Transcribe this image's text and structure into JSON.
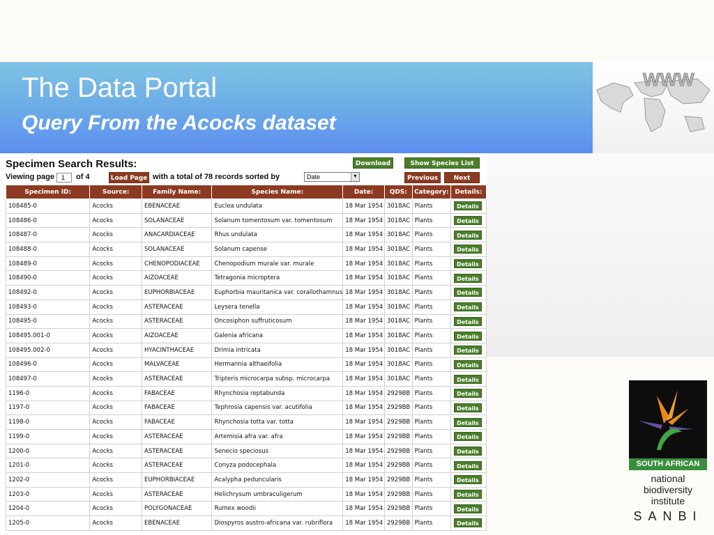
{
  "slide": {
    "title": "The Data Portal",
    "subtitle": "Query From the Acocks dataset",
    "globe_label": "WWW"
  },
  "app": {
    "heading": "Specimen Search Results:",
    "download_label": "Download",
    "show_species_label": "Show Species List",
    "viewing_label": "Viewing page",
    "page_value": "1",
    "of_label": "of 4",
    "load_page_label": "Load Page",
    "total_label": "with a total of 78 records sorted by",
    "sort_value": "Date",
    "previous_label": "Previous",
    "next_label": "Next"
  },
  "table": {
    "headers": [
      "Specimen ID:",
      "Source:",
      "Family Name:",
      "Species Name:",
      "Date:",
      "QDS:",
      "Category:",
      "Details:"
    ],
    "details_label": "Details",
    "rows": [
      [
        "108485-0",
        "Acocks",
        "EBENACEAE",
        "Euclea undulata",
        "18 Mar 1954",
        "3018AC",
        "Plants"
      ],
      [
        "108486-0",
        "Acocks",
        "SOLANACEAE",
        "Solanum tomentosum var. tomentosum",
        "18 Mar 1954",
        "3018AC",
        "Plants"
      ],
      [
        "108487-0",
        "Acocks",
        "ANACARDIACEAE",
        "Rhus undulata",
        "18 Mar 1954",
        "3018AC",
        "Plants"
      ],
      [
        "108488-0",
        "Acocks",
        "SOLANACEAE",
        "Solanum capense",
        "18 Mar 1954",
        "3018AC",
        "Plants"
      ],
      [
        "108489-0",
        "Acocks",
        "CHENOPODIACEAE",
        "Chenopodium murale var. murale",
        "18 Mar 1954",
        "3018AC",
        "Plants"
      ],
      [
        "108490-0",
        "Acocks",
        "AIZOACEAE",
        "Tetragonia microptera",
        "18 Mar 1954",
        "3018AC",
        "Plants"
      ],
      [
        "108492-0",
        "Acocks",
        "EUPHORBIACEAE",
        "Euphorbia mauritanica var. corallothamnus",
        "18 Mar 1954",
        "3018AC",
        "Plants"
      ],
      [
        "108493-0",
        "Acocks",
        "ASTERACEAE",
        "Leysera tenella",
        "18 Mar 1954",
        "3018AC",
        "Plants"
      ],
      [
        "108495-0",
        "Acocks",
        "ASTERACEAE",
        "Oncosiphon suffruticosum",
        "18 Mar 1954",
        "3018AC",
        "Plants"
      ],
      [
        "108495.001-0",
        "Acocks",
        "AIZOACEAE",
        "Galenia africana",
        "18 Mar 1954",
        "3018AC",
        "Plants"
      ],
      [
        "108495.002-0",
        "Acocks",
        "HYACINTHACEAE",
        "Drimia intricata",
        "18 Mar 1954",
        "3018AC",
        "Plants"
      ],
      [
        "108496-0",
        "Acocks",
        "MALVACEAE",
        "Hermannia althaeifolia",
        "18 Mar 1954",
        "3018AC",
        "Plants"
      ],
      [
        "108497-0",
        "Acocks",
        "ASTERACEAE",
        "Tripteris microcarpa subsp. microcarpa",
        "18 Mar 1954",
        "3018AC",
        "Plants"
      ],
      [
        "1196-0",
        "Acocks",
        "FABACEAE",
        "Rhynchosia reptabunda",
        "18 Mar 1954",
        "2929BB",
        "Plants"
      ],
      [
        "1197-0",
        "Acocks",
        "FABACEAE",
        "Tephrosia capensis var. acutifolia",
        "18 Mar 1954",
        "2929BB",
        "Plants"
      ],
      [
        "1198-0",
        "Acocks",
        "FABACEAE",
        "Rhynchosia totta var. totta",
        "18 Mar 1954",
        "2929BB",
        "Plants"
      ],
      [
        "1199-0",
        "Acocks",
        "ASTERACEAE",
        "Artemisia afra var. afra",
        "18 Mar 1954",
        "2929BB",
        "Plants"
      ],
      [
        "1200-0",
        "Acocks",
        "ASTERACEAE",
        "Senecio speciosus",
        "18 Mar 1954",
        "2929BB",
        "Plants"
      ],
      [
        "1201-0",
        "Acocks",
        "ASTERACEAE",
        "Conyza podocephala",
        "18 Mar 1954",
        "2929BB",
        "Plants"
      ],
      [
        "1202-0",
        "Acocks",
        "EUPHORBIACEAE",
        "Acalypha peduncularis",
        "18 Mar 1954",
        "2929BB",
        "Plants"
      ],
      [
        "1203-0",
        "Acocks",
        "ASTERACEAE",
        "Helichrysum umbraculigerum",
        "18 Mar 1954",
        "2929BB",
        "Plants"
      ],
      [
        "1204-0",
        "Acocks",
        "POLYGONACEAE",
        "Rumex woodii",
        "18 Mar 1954",
        "2929BB",
        "Plants"
      ],
      [
        "1205-0",
        "Acocks",
        "EBENACEAE",
        "Diospyros austro-africana var. rubriflora",
        "18 Mar 1954",
        "2929BB",
        "Plants"
      ]
    ]
  },
  "logo": {
    "band": "SOUTH AFRICAN",
    "line1": "national",
    "line2": "biodiversity",
    "line3": "institute",
    "acronym": "SANBI"
  },
  "colors": {
    "accent_red": "#8c3a22",
    "accent_green": "#4a7e2a",
    "banner_blue": "#6aa9e8"
  }
}
